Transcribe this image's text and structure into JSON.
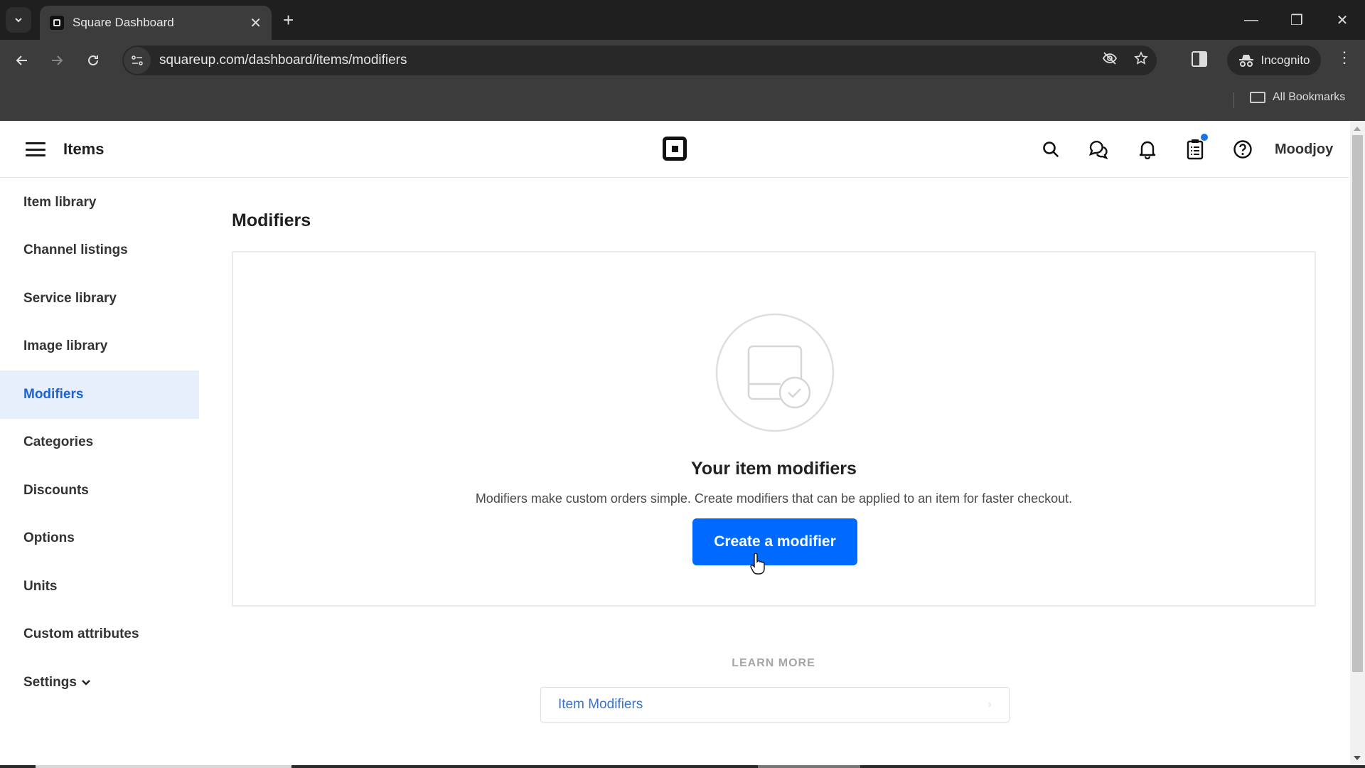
{
  "browser": {
    "tab_title": "Square Dashboard",
    "url": "squareup.com/dashboard/items/modifiers",
    "profile_label": "Incognito",
    "bookmarks_label": "All Bookmarks",
    "icons": {
      "tab_search": "chevron-down-icon",
      "tab_close": "close-icon",
      "new_tab": "plus-icon",
      "back": "arrow-left-icon",
      "forward": "arrow-right-icon",
      "reload": "reload-icon",
      "site_info": "tune-icon",
      "eye_off": "eye-off-icon",
      "bookmark_star": "star-icon",
      "side_panel": "side-panel-icon",
      "incognito": "incognito-icon",
      "menu": "more-vert-icon",
      "folder": "folder-icon"
    },
    "window_controls": {
      "minimize": "—",
      "restore": "❐",
      "close": "✕"
    }
  },
  "app_header": {
    "title": "Items",
    "account_name": "Moodjoy",
    "icons": [
      "search-icon",
      "messages-icon",
      "bell-icon",
      "clipboard-icon",
      "help-icon"
    ],
    "notification_dot_color": "#1a73e8"
  },
  "sidebar": {
    "items": [
      {
        "label": "Item library",
        "active": false
      },
      {
        "label": "Channel listings",
        "active": false
      },
      {
        "label": "Service library",
        "active": false
      },
      {
        "label": "Image library",
        "active": false
      },
      {
        "label": "Modifiers",
        "active": true
      },
      {
        "label": "Categories",
        "active": false
      },
      {
        "label": "Discounts",
        "active": false
      },
      {
        "label": "Options",
        "active": false
      },
      {
        "label": "Units",
        "active": false
      },
      {
        "label": "Custom attributes",
        "active": false
      },
      {
        "label": "Settings",
        "active": false,
        "expandable": true
      }
    ]
  },
  "main": {
    "page_title": "Modifiers",
    "empty_state": {
      "title": "Your item modifiers",
      "description": "Modifiers make custom orders simple. Create modifiers that can be applied to an item for faster checkout.",
      "cta_label": "Create a modifier"
    },
    "learn_more": {
      "label": "LEARN MORE",
      "links": [
        {
          "label": "Item Modifiers"
        }
      ]
    }
  },
  "colors": {
    "primary": "#006aff",
    "active_nav_bg": "#e8effc",
    "active_nav_text": "#1b63d2",
    "link": "#3b73c9"
  }
}
